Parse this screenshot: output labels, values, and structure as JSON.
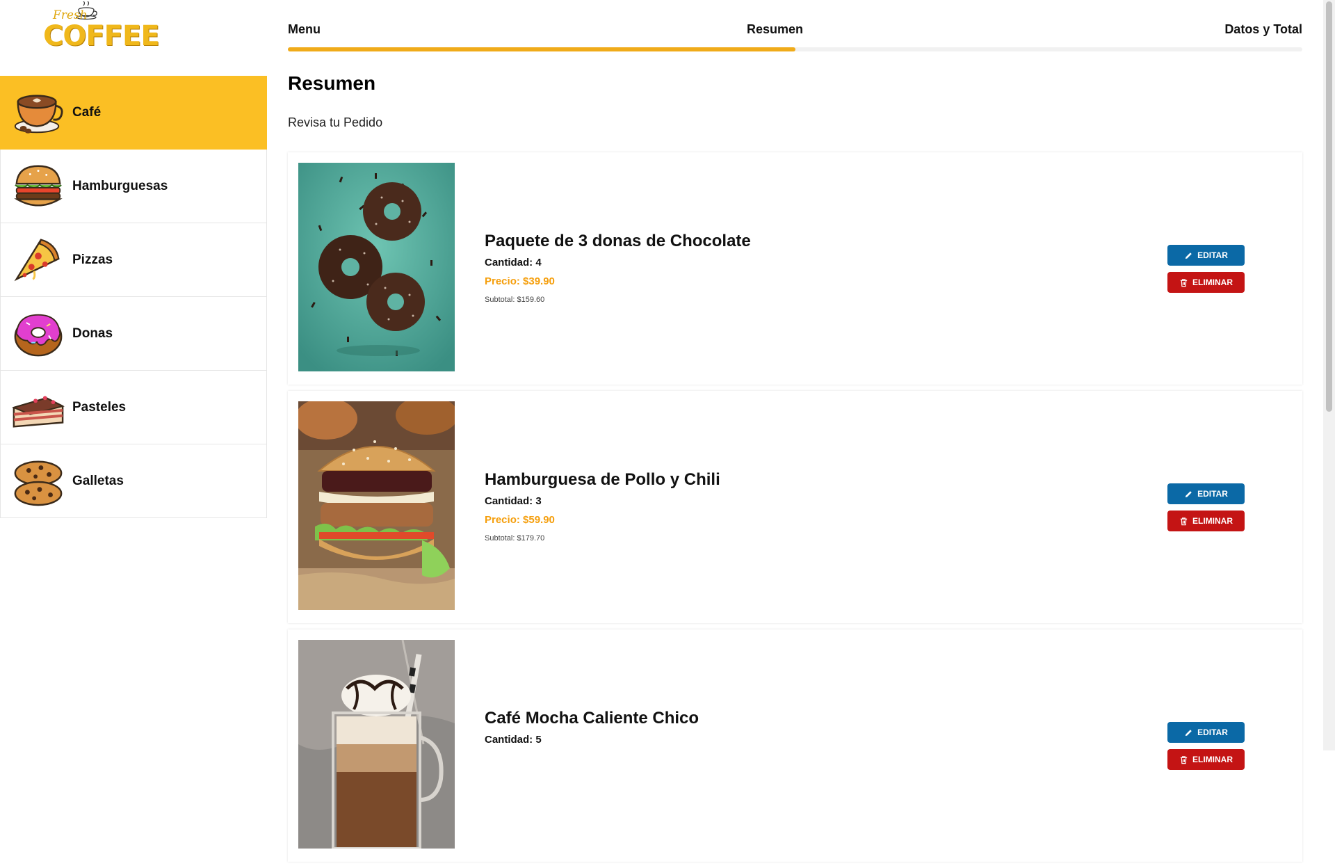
{
  "brand": {
    "logo_script": "Fresh",
    "logo_word": "COFFEE"
  },
  "categories": [
    {
      "label": "Café",
      "icon": "coffee-cup-icon",
      "active": true
    },
    {
      "label": "Hamburguesas",
      "icon": "burger-icon",
      "active": false
    },
    {
      "label": "Pizzas",
      "icon": "pizza-slice-icon",
      "active": false
    },
    {
      "label": "Donas",
      "icon": "donut-icon",
      "active": false
    },
    {
      "label": "Pasteles",
      "icon": "cake-slice-icon",
      "active": false
    },
    {
      "label": "Galletas",
      "icon": "cookies-icon",
      "active": false
    }
  ],
  "steps": {
    "items": [
      {
        "label": "Menu"
      },
      {
        "label": "Resumen"
      },
      {
        "label": "Datos y Total"
      }
    ],
    "progress_percent": 50,
    "accent_color": "#f0ab1a"
  },
  "page": {
    "title": "Resumen",
    "subtitle": "Revisa tu Pedido"
  },
  "orders": [
    {
      "name": "Paquete de 3 donas de Chocolate",
      "quantity": "Cantidad: 4",
      "price": "Precio: $39.90",
      "subtotal": "Subtotal: $159.60",
      "image": "chocolate-donuts-photo"
    },
    {
      "name": "Hamburguesa de Pollo y Chili",
      "quantity": "Cantidad: 3",
      "price": "Precio: $59.90",
      "subtotal": "Subtotal: $179.70",
      "image": "chicken-chili-burger-photo"
    },
    {
      "name": "Café Mocha Caliente Chico",
      "quantity": "Cantidad: 5",
      "price": "",
      "subtotal": "",
      "image": "mocha-coffee-photo"
    }
  ],
  "actions": {
    "edit_label": "Editar",
    "delete_label": "Eliminar",
    "edit_color": "#0b69a6",
    "delete_color": "#c41414"
  },
  "colors": {
    "active_category": "#fbbf24",
    "price": "#f59e0b"
  }
}
